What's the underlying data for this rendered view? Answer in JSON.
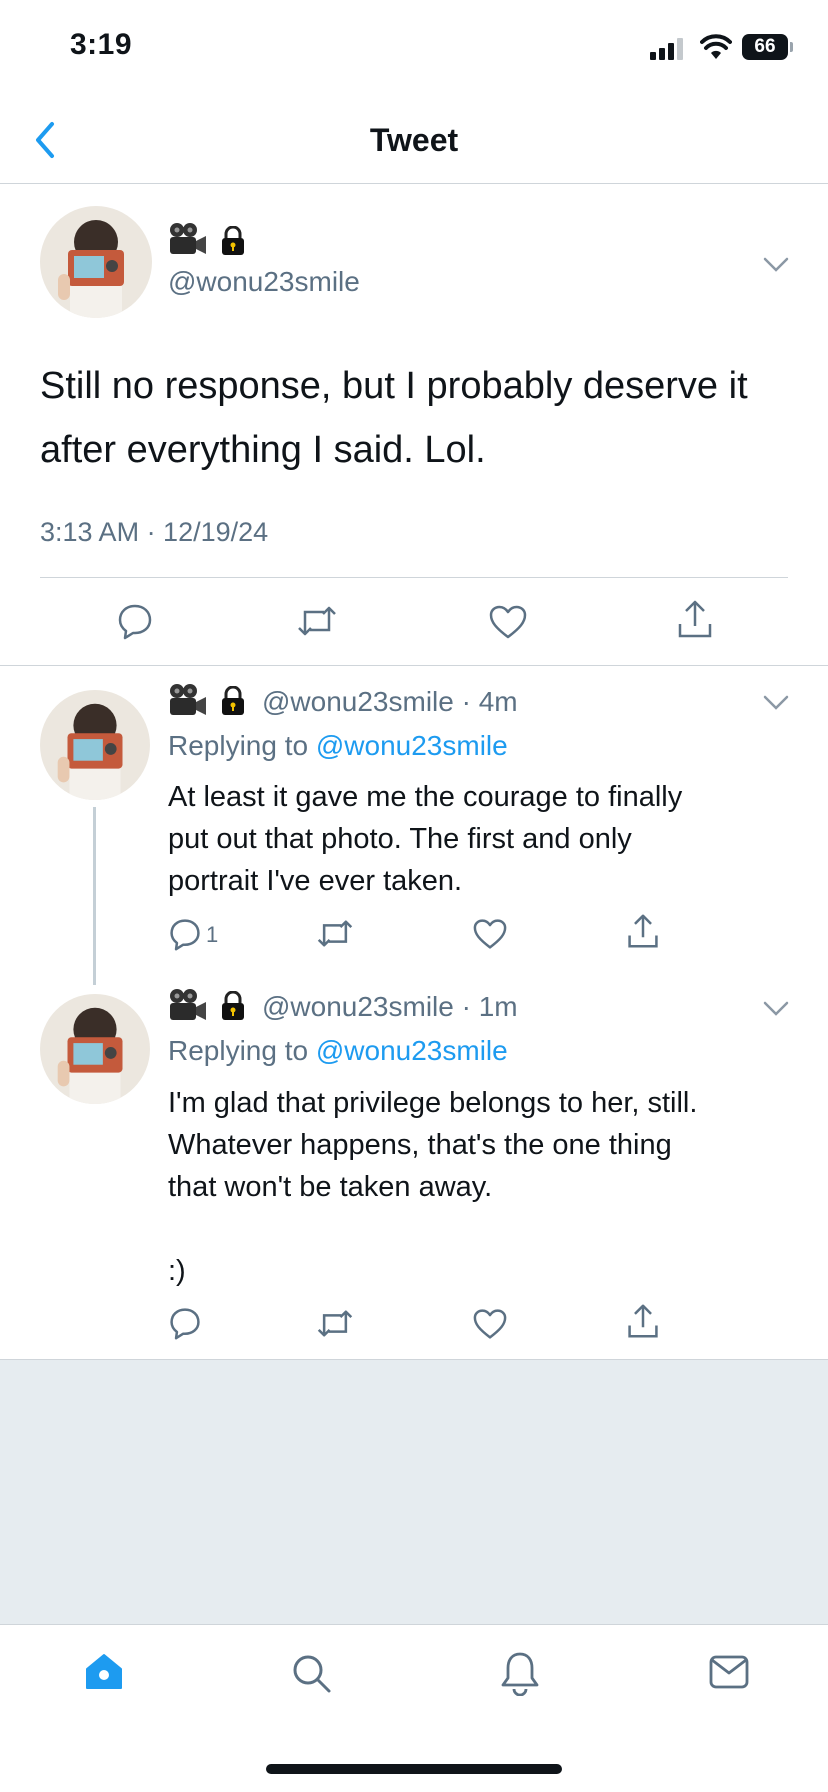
{
  "status_bar": {
    "time": "3:19",
    "battery": "66"
  },
  "header": {
    "title": "Tweet"
  },
  "main_tweet": {
    "handle": "@wonu23smile",
    "text": "Still no response, but I probably deserve it after everything I said. Lol.",
    "timestamp": "3:13 AM · 12/19/24"
  },
  "replies": [
    {
      "handle": "@wonu23smile",
      "time": "· 4m",
      "replying_label": "Replying to",
      "replying_to": "@wonu23smile",
      "text_lines": [
        "At least it gave me the courage to finally",
        "put out that photo. The first and only",
        "portrait I've ever taken."
      ],
      "reply_count": "1"
    },
    {
      "handle": "@wonu23smile",
      "time": "· 1m",
      "replying_label": "Replying to",
      "replying_to": "@wonu23smile",
      "text_lines": [
        "I'm glad that privilege belongs to her, still.",
        "Whatever happens, that's the one thing",
        "that won't be taken away.",
        "",
        ":)"
      ],
      "reply_count": ""
    }
  ],
  "icons": {
    "name_emoji": [
      "movie-camera-icon",
      "lock-icon"
    ],
    "actions": [
      "reply-icon",
      "retweet-icon",
      "like-icon",
      "share-icon"
    ],
    "tabbar": [
      "home-icon",
      "search-icon",
      "notifications-icon",
      "messages-icon"
    ]
  },
  "colors": {
    "accent": "#1d9bf0",
    "secondary_text": "#5b7083",
    "background_fill": "#e6ecf0"
  }
}
